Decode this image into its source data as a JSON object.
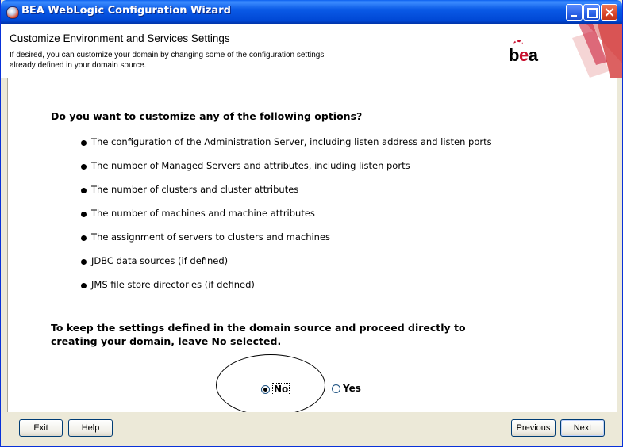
{
  "window": {
    "title": "BEA WebLogic Configuration Wizard"
  },
  "header": {
    "title": "Customize Environment and Services Settings",
    "description": "If desired, you can customize your domain by changing some of the configuration settings already defined in your domain source.",
    "logo": {
      "prefix": "b",
      "accent": "e",
      "suffix": "a",
      "accent_color": "#c8102e"
    }
  },
  "main": {
    "question": "Do you want to customize any of the following options?",
    "options": [
      "The configuration of the Administration Server, including listen address and listen ports",
      "The number of Managed Servers and attributes, including listen ports",
      "The number of clusters and cluster attributes",
      "The number of machines and machine attributes",
      "The assignment of servers to clusters and machines",
      "JDBC data sources (if defined)",
      "JMS file store directories (if defined)"
    ],
    "keep_text": "To keep the settings defined in the domain source and proceed directly to creating your domain, leave No selected.",
    "choice": {
      "no_label": "No",
      "yes_label": "Yes",
      "selected": "No"
    }
  },
  "footer": {
    "exit_label": "Exit",
    "help_label": "Help",
    "previous_label": "Previous",
    "next_label": "Next"
  },
  "colors": {
    "titlebar": "#0a5ae6",
    "window_face": "#ece9d8",
    "bea_red": "#c8102e"
  }
}
